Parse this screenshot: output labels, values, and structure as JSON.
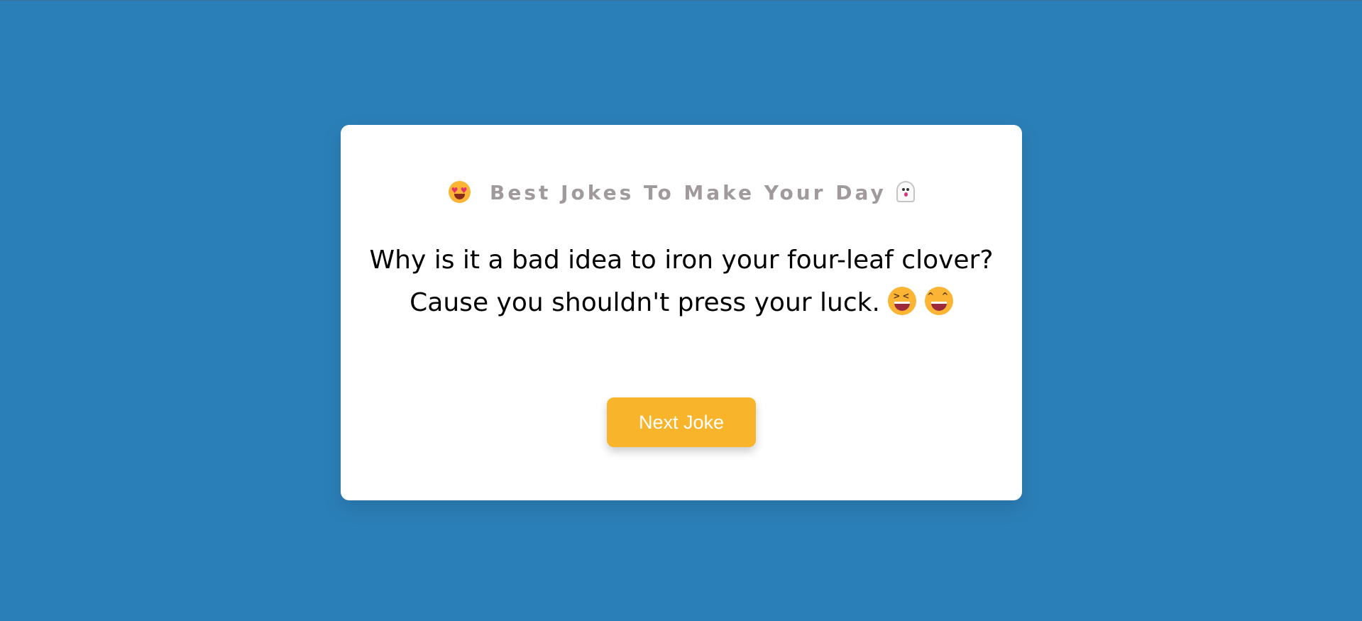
{
  "header": {
    "title": "Best Jokes To Make Your Day",
    "leading_icon": "heart-eyes-emoji",
    "trailing_icon": "ghost-emoji"
  },
  "joke": {
    "text": "Why is it a bad idea to iron your four-leaf clover? Cause you shouldn't press your luck.",
    "trailing_icons": [
      "laughing-emoji",
      "grinning-emoji"
    ]
  },
  "controls": {
    "next_label": "Next Joke"
  },
  "colors": {
    "background": "#2b7fb8",
    "card": "#ffffff",
    "heading_text": "#a09a9c",
    "button": "#f8b42a",
    "button_text": "#ffffff"
  }
}
